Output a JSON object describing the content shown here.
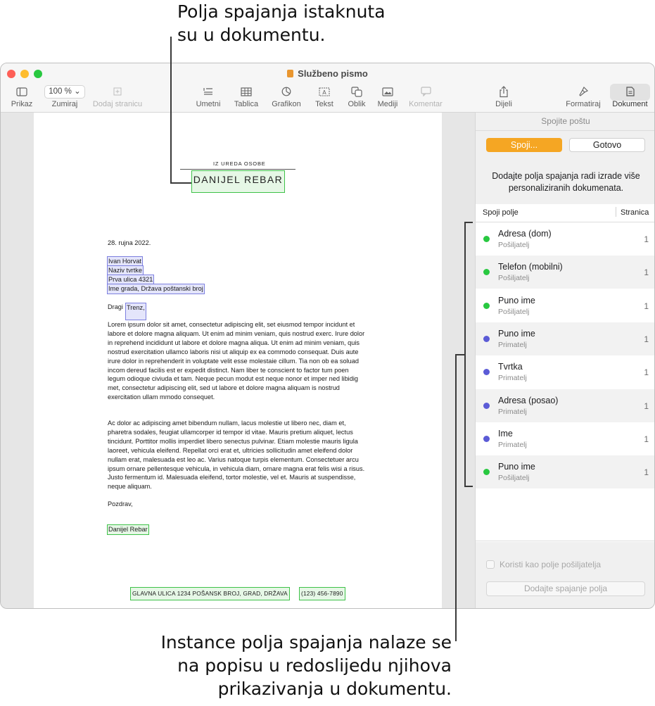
{
  "callouts": {
    "top": [
      "Polja spajanja istaknuta",
      "su u dokumentu."
    ],
    "bottom": [
      "Instance polja spajanja nalaze se",
      "na popisu u redoslijedu njihova",
      "prikazivanja u dokumentu."
    ]
  },
  "window": {
    "title": "Službeno pismo",
    "traffic_colors": [
      "#fe5f57",
      "#febc2e",
      "#28c840"
    ]
  },
  "toolbar": {
    "view": "Prikaz",
    "zoom_value": "100 %",
    "zoom": "Zumiraj",
    "add_page": "Dodaj stranicu",
    "insert": "Umetni",
    "table": "Tablica",
    "chart": "Grafikon",
    "text": "Tekst",
    "shape": "Oblik",
    "media": "Mediji",
    "comment": "Komentar",
    "share": "Dijeli",
    "format": "Formatiraj",
    "document": "Dokument"
  },
  "letter": {
    "header_small": "IZ UREDA OSOBE",
    "header_name": "DANIJEL REBAR",
    "date": "28. rujna 2022.",
    "address": [
      "Ivan Horvat",
      "Naziv tvrtke",
      "Prva ulica 4321",
      "Ime grada, Država poštanski broj"
    ],
    "greeting_prefix": "Dragi",
    "greeting_field": "Trenz,",
    "para1": "Lorem ipsum dolor sit amet, consectetur adipiscing elit, set eiusmod tempor incidunt et labore et dolore magna aliquam. Ut enim ad minim veniam, quis nostrud exerc. Irure dolor in reprehend incididunt ut labore et dolore magna aliqua. Ut enim ad minim veniam, quis nostrud exercitation ullamco laboris nisi ut aliquip ex ea commodo consequat. Duis aute irure dolor in reprehenderit in voluptate velit esse molestaie cillum. Tia non ob ea soluad incom dereud facilis est er expedit distinct. Nam liber te conscient to factor tum poen legum odioque civiuda et tam. Neque pecun modut est neque nonor et imper ned libidig met, consectetur adipiscing elit, sed ut labore et dolore magna aliquam is nostrud exercitation ullam mmodo consequet.",
    "para2": "Ac dolor ac adipiscing amet bibendum nullam, lacus molestie ut libero nec, diam et, pharetra sodales, feugiat ullamcorper id tempor id vitae. Mauris pretium aliquet, lectus tincidunt. Porttitor mollis imperdiet libero senectus pulvinar. Etiam molestie mauris ligula laoreet, vehicula eleifend. Repellat orci erat et, ultricies sollicitudin amet eleifend dolor nullam erat, malesuada est leo ac. Varius natoque turpis elementum. Consectetuer arcu ipsum ornare pellentesque vehicula, in vehicula diam, ornare magna erat felis wisi a risus. Justo fermentum id. Malesuada eleifend, tortor molestie, vel et. Mauris at suspendisse, neque aliquam.",
    "closing": "Pozdrav,",
    "signature": "Danijel Rebar",
    "footer_address": "GLAVNA ULICA 1234   POŠANSK BROJ, GRAD, DRŽAVA",
    "footer_phone": "(123) 456-7890"
  },
  "sidebar": {
    "title": "Spojite poštu",
    "merge_button": "Spoji...",
    "done_button": "Gotovo",
    "description": "Dodajte polja spajanja radi izrade više personaliziranih dokumenata.",
    "col_field": "Spoji polje",
    "col_page": "Stranica",
    "colors": {
      "sender": "#28c840",
      "recipient": "#5b5bd6"
    },
    "fields": [
      {
        "name": "Adresa (dom)",
        "type": "Pošiljatelj",
        "page": "1",
        "kind": "sender"
      },
      {
        "name": "Telefon (mobilni)",
        "type": "Pošiljatelj",
        "page": "1",
        "kind": "sender"
      },
      {
        "name": "Puno ime",
        "type": "Pošiljatelj",
        "page": "1",
        "kind": "sender"
      },
      {
        "name": "Puno ime",
        "type": "Primatelj",
        "page": "1",
        "kind": "recipient"
      },
      {
        "name": "Tvrtka",
        "type": "Primatelj",
        "page": "1",
        "kind": "recipient"
      },
      {
        "name": "Adresa (posao)",
        "type": "Primatelj",
        "page": "1",
        "kind": "recipient"
      },
      {
        "name": "Ime",
        "type": "Primatelj",
        "page": "1",
        "kind": "recipient"
      },
      {
        "name": "Puno ime",
        "type": "Pošiljatelj",
        "page": "1",
        "kind": "sender"
      }
    ],
    "checkbox_label": "Koristi kao polje pošiljatelja",
    "add_button": "Dodajte spajanje polja"
  }
}
